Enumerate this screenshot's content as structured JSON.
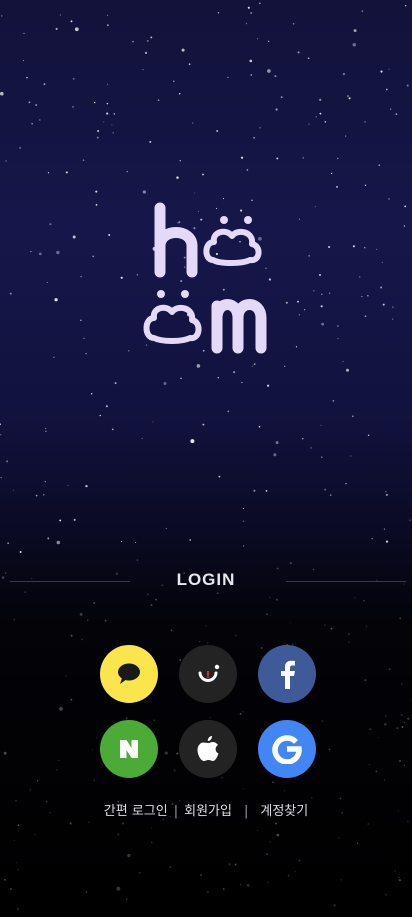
{
  "app": {
    "name": "hoom"
  },
  "login": {
    "title": "LOGIN"
  },
  "social_buttons": [
    {
      "id": "kakao",
      "icon": "kakao-chat-bubble-icon",
      "color": "#FAE54D"
    },
    {
      "id": "smile",
      "icon": "smile-face-icon",
      "color": "#232323"
    },
    {
      "id": "facebook",
      "icon": "facebook-f-icon",
      "color": "#3F5A99"
    },
    {
      "id": "naver",
      "icon": "naver-n-icon",
      "color": "#4CAA36"
    },
    {
      "id": "apple",
      "icon": "apple-icon",
      "color": "#232323"
    },
    {
      "id": "google",
      "icon": "google-g-icon",
      "color": "#4285F4"
    }
  ],
  "links": {
    "easy_login": "간편 로그인",
    "signup": "회원가입",
    "find_account": "계정찾기",
    "separator": "|"
  },
  "colors": {
    "logo": "#E4DAF8",
    "accent_red": "#E03A3A"
  }
}
